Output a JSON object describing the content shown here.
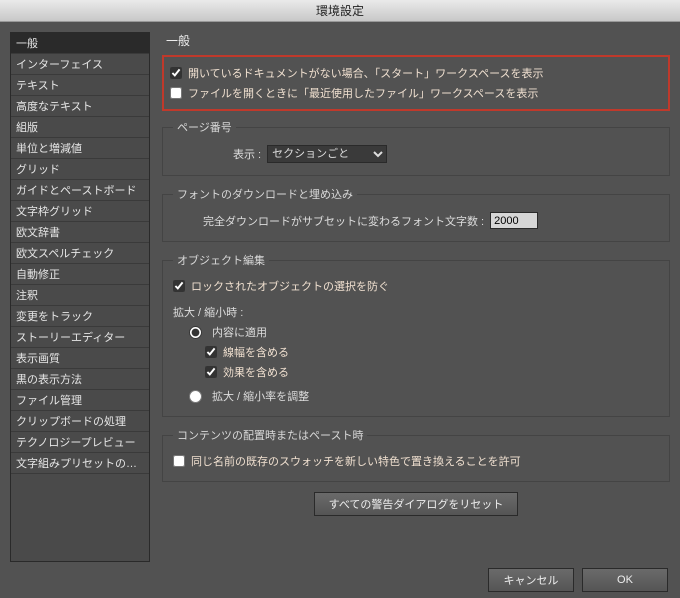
{
  "window": {
    "title": "環境設定"
  },
  "sidebar": {
    "items": [
      "一般",
      "インターフェイス",
      "テキスト",
      "高度なテキスト",
      "組版",
      "単位と増減値",
      "グリッド",
      "ガイドとペーストボード",
      "文字枠グリッド",
      "欧文辞書",
      "欧文スペルチェック",
      "自動修正",
      "注釈",
      "変更をトラック",
      "ストーリーエディター",
      "表示画質",
      "黒の表示方法",
      "ファイル管理",
      "クリップボードの処理",
      "テクノロジープレビュー",
      "文字組みプリセットの表示設定"
    ],
    "selected_index": 0
  },
  "panel": {
    "title": "一般",
    "top": {
      "show_start": {
        "checked": true,
        "label": "開いているドキュメントがない場合、「スタート」ワークスペースを表示"
      },
      "show_recent": {
        "checked": false,
        "label": "ファイルを開くときに「最近使用したファイル」ワークスペースを表示"
      }
    },
    "page_numbering": {
      "legend": "ページ番号",
      "display_label": "表示 :",
      "display_value": "セクションごと"
    },
    "font": {
      "legend": "フォントのダウンロードと埋め込み",
      "threshold_label": "完全ダウンロードがサブセットに変わるフォント文字数 :",
      "threshold_value": "2000"
    },
    "object": {
      "legend": "オブジェクト編集",
      "prevent_locked": {
        "checked": true,
        "label": "ロックされたオブジェクトの選択を防ぐ"
      },
      "scaling_label": "拡大 / 縮小時 :",
      "radio_apply": {
        "selected": true,
        "label": "内容に適用"
      },
      "include_strokes": {
        "checked": true,
        "label": "線幅を含める"
      },
      "include_effects": {
        "checked": true,
        "label": "効果を含める"
      },
      "radio_adjust": {
        "selected": false,
        "label": "拡大 / 縮小率を調整"
      }
    },
    "content": {
      "legend": "コンテンツの配置時またはペースト時",
      "swatch_replace": {
        "checked": false,
        "label": "同じ名前の既存のスウォッチを新しい特色で置き換えることを許可"
      }
    },
    "reset_button": "すべての警告ダイアログをリセット"
  },
  "footer": {
    "cancel": "キャンセル",
    "ok": "OK"
  }
}
